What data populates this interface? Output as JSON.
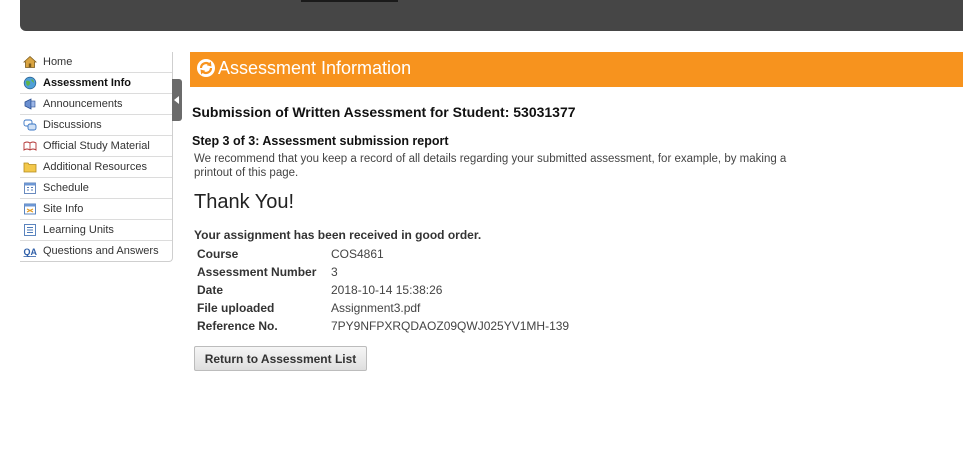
{
  "sidebar": {
    "items": [
      {
        "label": "Home",
        "icon": "home-icon"
      },
      {
        "label": "Assessment Info",
        "icon": "globe-icon"
      },
      {
        "label": "Announcements",
        "icon": "megaphone-icon"
      },
      {
        "label": "Discussions",
        "icon": "speech-bubbles-icon"
      },
      {
        "label": "Official Study Material",
        "icon": "book-icon"
      },
      {
        "label": "Additional Resources",
        "icon": "folder-icon"
      },
      {
        "label": "Schedule",
        "icon": "calendar-icon"
      },
      {
        "label": "Site Info",
        "icon": "info-icon"
      },
      {
        "label": "Learning Units",
        "icon": "list-icon"
      },
      {
        "label": "Questions and Answers",
        "icon": "qa-icon"
      }
    ],
    "active": "Assessment Info"
  },
  "banner": {
    "title": "Assessment Information",
    "color": "#f7931e"
  },
  "main": {
    "heading": "Submission of Written Assessment for Student: 53031377",
    "step": "Step 3 of 3: Assessment submission report",
    "recommend": "We recommend that you keep a record of all details regarding your submitted assessment, for example, by making a printout of this page.",
    "thanks": "Thank You!",
    "received": "Your assignment has been received in good order.",
    "details": [
      {
        "label": "Course",
        "value": "COS4861"
      },
      {
        "label": "Assessment Number",
        "value": "3"
      },
      {
        "label": "Date",
        "value": "2018-10-14 15:38:26"
      },
      {
        "label": "File uploaded",
        "value": "Assignment3.pdf"
      },
      {
        "label": "Reference No.",
        "value": "7PY9NFPXRQDAOZ09QWJ025YV1MH-139"
      }
    ],
    "return_label": "Return to Assessment List"
  }
}
